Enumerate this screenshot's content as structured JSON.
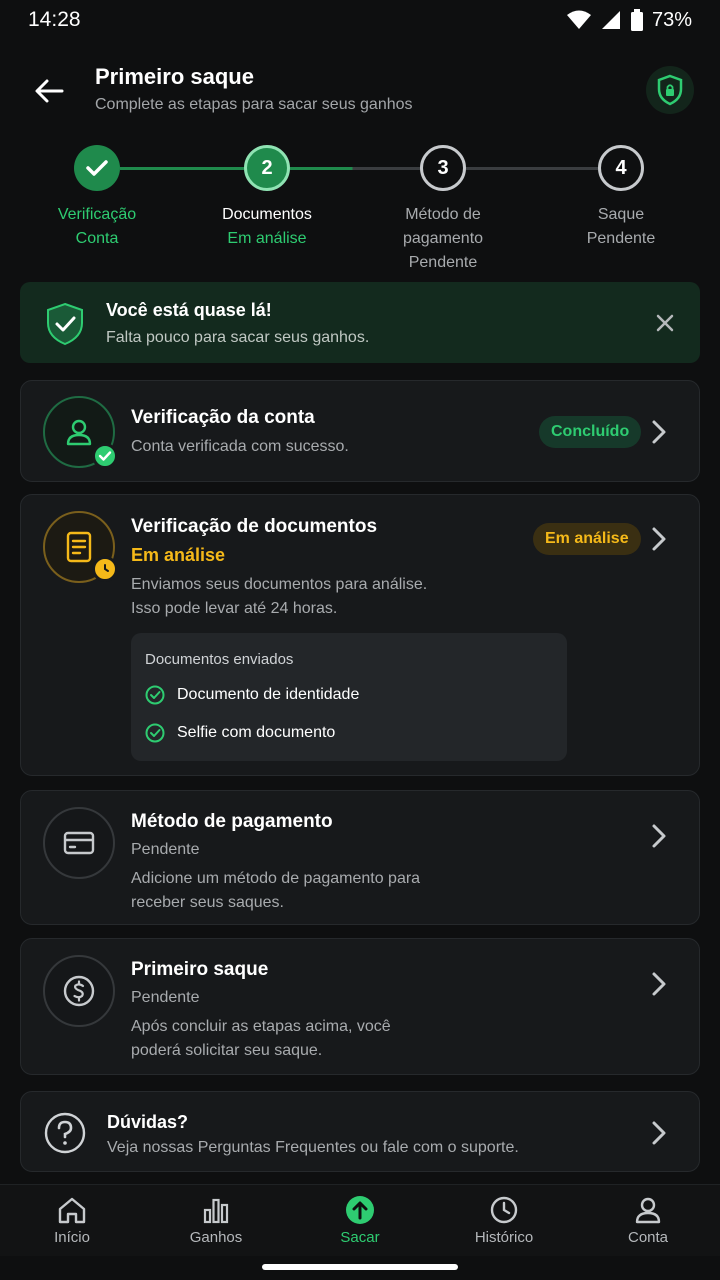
{
  "status_bar": {
    "time": "14:28",
    "battery": "73%"
  },
  "header": {
    "title": "Primeiro saque",
    "subtitle": "Complete as etapas para sacar seus ganhos"
  },
  "stepper": {
    "steps": [
      {
        "number": "",
        "label": "Verificação",
        "status": "Conta"
      },
      {
        "number": "2",
        "label": "Documentos",
        "status": "Em análise"
      },
      {
        "number": "3",
        "label_line1": "Método de",
        "label_line2": "pagamento",
        "status": "Pendente"
      },
      {
        "number": "4",
        "label": "Saque",
        "status": "Pendente"
      }
    ]
  },
  "banner": {
    "title": "Você está quase lá!",
    "subtitle": "Falta pouco para sacar seus ganhos."
  },
  "cards": {
    "account": {
      "title": "Verificação da conta",
      "description": "Conta verificada com sucesso.",
      "badge": "Concluído"
    },
    "documents": {
      "title": "Verificação de documentos",
      "status": "Em análise",
      "badge": "Em análise",
      "description_line1": "Enviamos seus documentos para análise.",
      "description_line2": "Isso pode levar até 24 horas.",
      "docs_title": "Documentos enviados",
      "docs": [
        "Documento de identidade",
        "Selfie com documento"
      ]
    },
    "payment": {
      "title": "Método de pagamento",
      "status": "Pendente",
      "description_line1": "Adicione um método de pagamento para",
      "description_line2": "receber seus saques."
    },
    "withdraw": {
      "title": "Primeiro saque",
      "status": "Pendente",
      "description_line1": "Após concluir as etapas acima, você",
      "description_line2": "poderá solicitar seu saque."
    },
    "help": {
      "title": "Dúvidas?",
      "description": "Veja nossas Perguntas Frequentes ou fale com o suporte."
    }
  },
  "bottom_nav": {
    "items": [
      {
        "label": "Início",
        "icon": "home-icon"
      },
      {
        "label": "Ganhos",
        "icon": "chart-icon"
      },
      {
        "label": "Sacar",
        "icon": "upload-icon"
      },
      {
        "label": "Histórico",
        "icon": "clock-icon"
      },
      {
        "label": "Conta",
        "icon": "user-icon"
      }
    ],
    "active": "Sacar"
  },
  "colors": {
    "accent_green": "#2ecc71",
    "pending_yellow": "#f5b919",
    "background": "#0e0f10",
    "card": "#17191b"
  }
}
